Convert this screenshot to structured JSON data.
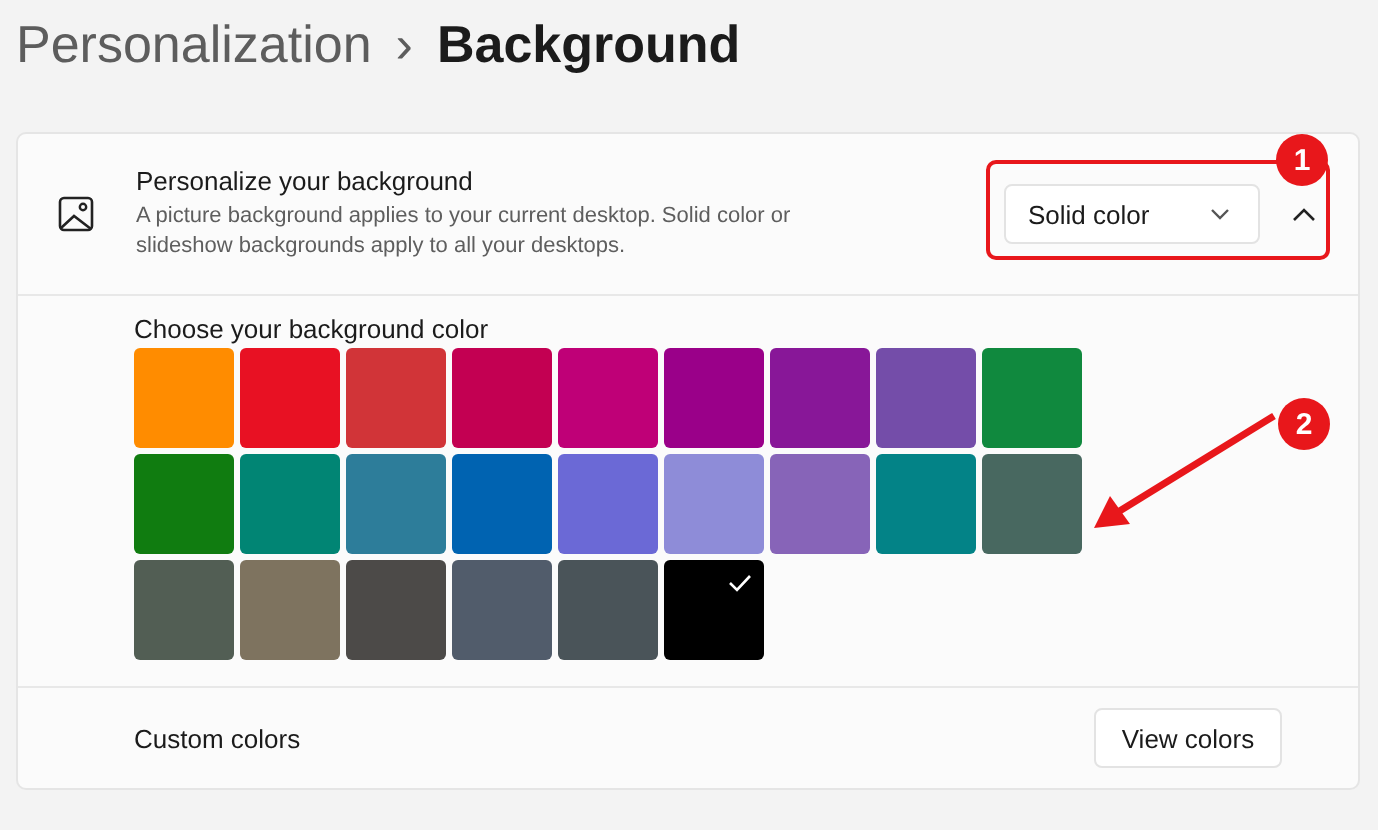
{
  "breadcrumb": {
    "parent": "Personalization",
    "separator": "›",
    "current": "Background"
  },
  "setting": {
    "title": "Personalize your background",
    "description": "A picture background applies to your current desktop. Solid color or slideshow backgrounds apply to all your desktops.",
    "dropdown": "Solid color",
    "expanded": true
  },
  "colors": {
    "label": "Choose your background color",
    "swatches": [
      {
        "color": "#ff8c00",
        "selected": false
      },
      {
        "color": "#e81123",
        "selected": false
      },
      {
        "color": "#d13438",
        "selected": false
      },
      {
        "color": "#c30052",
        "selected": false
      },
      {
        "color": "#bf0077",
        "selected": false
      },
      {
        "color": "#9a0089",
        "selected": false
      },
      {
        "color": "#881798",
        "selected": false
      },
      {
        "color": "#744da9",
        "selected": false
      },
      {
        "color": "#10893e",
        "selected": false
      },
      {
        "color": "#107c10",
        "selected": false
      },
      {
        "color": "#018574",
        "selected": false
      },
      {
        "color": "#2d7d9a",
        "selected": false
      },
      {
        "color": "#0063b1",
        "selected": false
      },
      {
        "color": "#6b69d6",
        "selected": false
      },
      {
        "color": "#8e8cd8",
        "selected": false
      },
      {
        "color": "#8764b8",
        "selected": false
      },
      {
        "color": "#038387",
        "selected": false
      },
      {
        "color": "#486860",
        "selected": false
      },
      {
        "color": "#525e54",
        "selected": false
      },
      {
        "color": "#7e735f",
        "selected": false
      },
      {
        "color": "#4c4a48",
        "selected": false
      },
      {
        "color": "#515c6b",
        "selected": false
      },
      {
        "color": "#4a5459",
        "selected": false
      },
      {
        "color": "#000000",
        "selected": true
      }
    ]
  },
  "custom": {
    "label": "Custom colors",
    "button": "View colors"
  },
  "callouts": [
    {
      "label": "1"
    },
    {
      "label": "2"
    }
  ]
}
